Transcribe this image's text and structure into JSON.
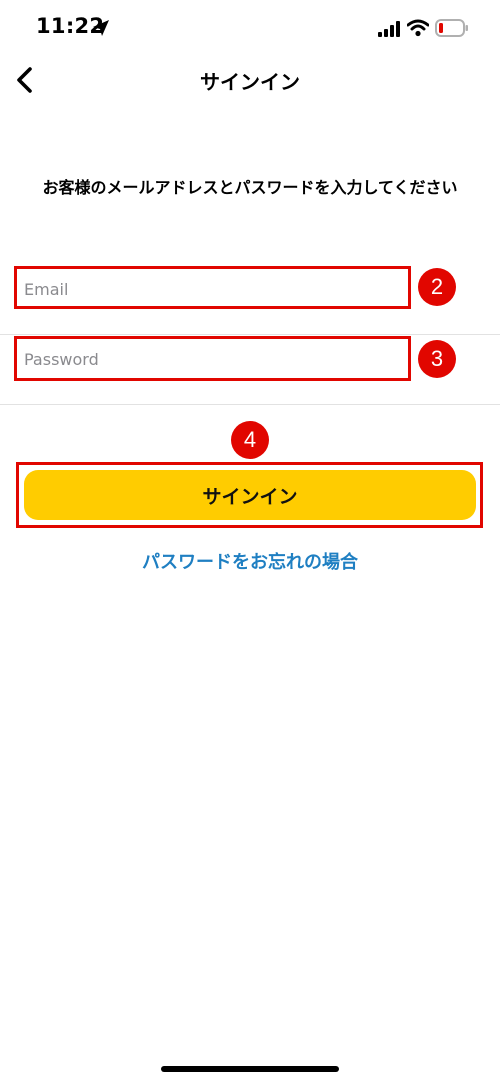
{
  "status_bar": {
    "time": "11:22",
    "icons": [
      "location-arrow-icon",
      "cellular-signal-icon",
      "wifi-icon",
      "battery-low-icon"
    ],
    "battery_color": "#e10600"
  },
  "nav": {
    "title": "サインイン",
    "back_icon": "chevron-left-icon"
  },
  "instruction": "お客様のメールアドレスとパスワードを入力してください",
  "form": {
    "email": {
      "placeholder": "Email",
      "value": ""
    },
    "password": {
      "placeholder": "Password",
      "value": ""
    }
  },
  "annotations": {
    "email_step": "2",
    "password_step": "3",
    "signin_step": "4",
    "color": "#e10600"
  },
  "signin_button": {
    "label": "サインイン",
    "color": "#ffcc00"
  },
  "forgot_password_link": {
    "label": "パスワードをお忘れの場合",
    "color": "#1f7fc2"
  }
}
